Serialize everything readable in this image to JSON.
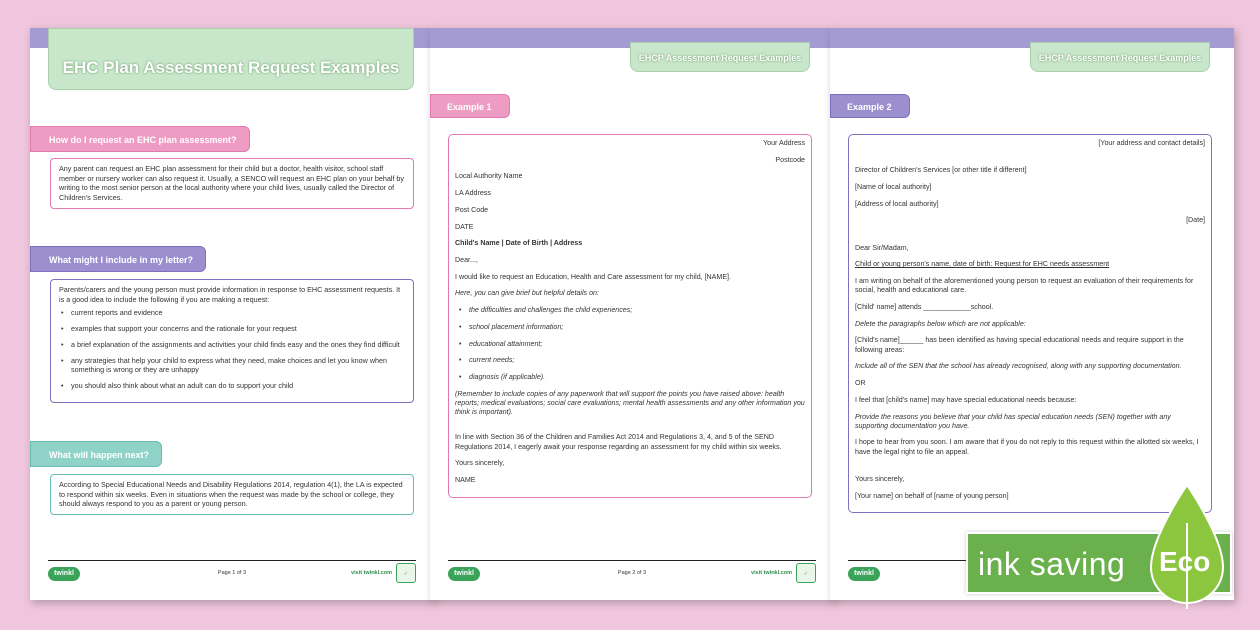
{
  "page1": {
    "title": "EHC Plan Assessment Request Examples",
    "sections": [
      {
        "label": "How do I request an EHC plan assessment?",
        "text": "Any parent can request an EHC plan assessment for their child but a doctor, health visitor, school staff member or nursery worker can also request it. Usually, a SENCO will request an EHC plan on your behalf by writing to the most senior person at the local authority where your child lives, usually called the Director of Children's Services."
      },
      {
        "label": "What might I include in my letter?",
        "intro": "Parents/carers and the young person must provide information in response to EHC assessment requests. It is a good idea to include the following if you are making a request:",
        "bullets": [
          "current reports and evidence",
          "examples that support your concerns and the rationale for your request",
          "a brief explanation of the assignments and activities your child finds easy and the ones they find difficult",
          "any strategies that help your child to express what they need, make choices and let you know when something is wrong or they are unhappy",
          "you should also think about what an adult can do to support your child"
        ]
      },
      {
        "label": "What will happen next?",
        "text": "According to Special Educational Needs and Disability Regulations 2014, regulation 4(1), the LA is expected to respond within six weeks. Even in situations when the request was made by the school or college, they should always respond to you as a parent or young person."
      }
    ],
    "page_num": "Page 1 of 3"
  },
  "page2": {
    "header": "EHCP Assessment Request Examples",
    "example_label": "Example 1",
    "lines": {
      "addr": "Your Address",
      "postcode": "Postcode",
      "la_name": "Local Authority Name",
      "la_addr": "LA Address",
      "post_code": "Post Code",
      "date": "DATE",
      "child": "Child's Name | Date of Birth | Address",
      "dear": "Dear...,",
      "request": "I would like to request an Education, Health and Care assessment for my child, [NAME].",
      "brief": "Here, you can give brief but helpful details on:",
      "b1": "the difficulties and challenges the child experiences;",
      "b2": "school placement information;",
      "b3": "educational attainment;",
      "b4": "current needs;",
      "b5": "diagnosis (if applicable).",
      "remember": "(Remember to include copies of any paperwork that will support the points you have raised above: health reports; medical evaluations; social care evaluations; mental health assessments and any other information you think is important).",
      "section36": "In line with Section 36 of the Children and Families Act 2014 and Regulations 3, 4, and 5 of the SEND Regulations 2014, I eagerly await your response regarding an assessment for my child within six weeks.",
      "yours": "Yours sincerely,",
      "name": "NAME"
    },
    "page_num": "Page 2 of 3"
  },
  "page3": {
    "header": "EHCP Assessment Request Examples",
    "example_label": "Example 2",
    "lines": {
      "addr": "[Your address and contact details]",
      "director": "Director of Children's Services [or other title if different]",
      "la_name": "[Name of local authority]",
      "la_addr": "[Address of local authority]",
      "date": "[Date]",
      "dear": "Dear Sir/Madam,",
      "subject": "Child or young person's name, date of birth: Request for EHC needs assessment",
      "writing": "I am writing on behalf of the aforementioned young person to request an evaluation of their requirements for social, health and educational care.",
      "attends": "[Child' name] attends ____________school.",
      "delete": "Delete the paragraphs below which are not applicable:",
      "identified": "[Child's name]______ has been identified as having special educational needs and require support in the following areas:",
      "include": "Include all of the SEN that the school has already recognised, along with any supporting documentation.",
      "or": "OR",
      "feel": "I feel that [child's name] may have special educational needs because:",
      "provide": "Provide the reasons you believe that your child has special education needs (SEN) together with any supporting documentation you have.",
      "hope": "I hope to hear from you soon. I am aware that if you do not reply to this request within the allotted six weeks, I have the legal right to file an appeal.",
      "yours": "Yours sincerely,",
      "behalf": "[Your name] on behalf of [name of young person]"
    }
  },
  "footer": {
    "logo": "twinkl",
    "visit": "visit twinkl.com"
  },
  "banner": {
    "ink": "ink saving",
    "eco": "Eco"
  }
}
